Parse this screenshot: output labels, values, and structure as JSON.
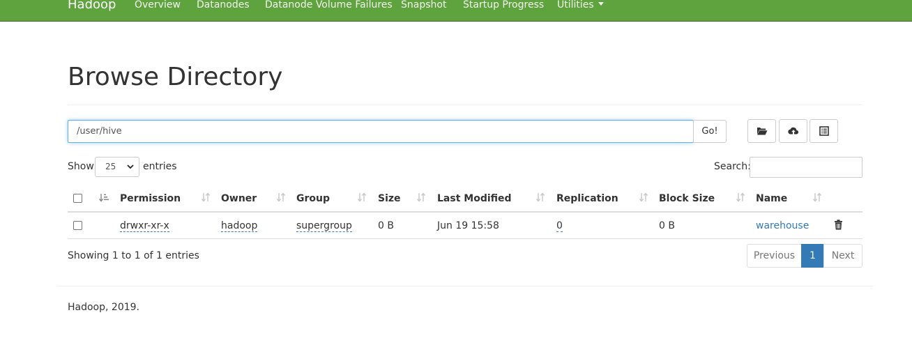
{
  "nav": {
    "brand": "Hadoop",
    "links": [
      "Overview",
      "Datanodes",
      "Datanode Volume Failures",
      "Snapshot",
      "Startup Progress",
      "Utilities"
    ]
  },
  "page": {
    "title": "Browse Directory"
  },
  "path_bar": {
    "value": "/user/hive",
    "go_label": "Go!"
  },
  "toolbar_icons": [
    "folder-open-icon",
    "cloud-upload-icon",
    "list-alt-icon"
  ],
  "table_controls": {
    "show_label": "Show",
    "page_size": "25",
    "entries_label": "entries",
    "search_label": "Search:",
    "search_value": ""
  },
  "table": {
    "columns": [
      "Permission",
      "Owner",
      "Group",
      "Size",
      "Last Modified",
      "Replication",
      "Block Size",
      "Name"
    ],
    "rows": [
      {
        "permission": "drwxr-xr-x",
        "owner": "hadoop",
        "group": "supergroup",
        "size": "0 B",
        "last_modified": "Jun 19 15:58",
        "replication": "0",
        "block_size": "0 B",
        "name": "warehouse"
      }
    ]
  },
  "pagination": {
    "info": "Showing 1 to 1 of 1 entries",
    "previous": "Previous",
    "current": "1",
    "next": "Next"
  },
  "footer": {
    "text": "Hadoop, 2019."
  },
  "colors": {
    "navbar": "#5fa33e",
    "link": "#337ab7",
    "active_page": "#337ab7"
  }
}
